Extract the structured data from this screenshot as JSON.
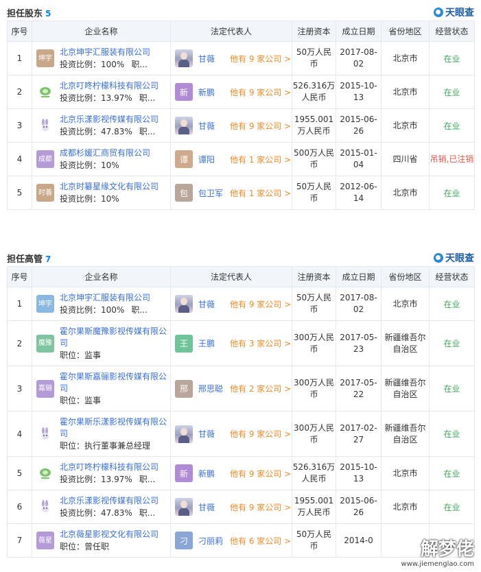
{
  "brand": "天眼查",
  "columns": [
    "序号",
    "企业名称",
    "法定代表人",
    "注册资本",
    "成立日期",
    "省份地区",
    "经营状态"
  ],
  "more_suffix": "职...",
  "shareholder": {
    "title": "担任股东",
    "count": "5",
    "rows": [
      {
        "no": "1",
        "logo": "坤宇",
        "logo_color": "#c9a88a",
        "name": "北京坤宇汇服装有限公司",
        "sub": "投资比例：100%",
        "more": true,
        "legal_photo": true,
        "legal_char": "",
        "legal_color": "",
        "legal": "甘薇",
        "legal_more": "他有 9 家公司 >",
        "capital": "50万人民币",
        "date": "2017-08-02",
        "region": "北京市",
        "status": "在业",
        "status_ok": true
      },
      {
        "no": "2",
        "logo": "",
        "logo_color": "#ffffff",
        "logo_icon": "lemon-icon",
        "name": "北京叮咚柠檬科技有限公司",
        "sub": "投资比例：13.97%",
        "more": true,
        "legal_photo": false,
        "legal_char": "新",
        "legal_color": "#b18ad8",
        "legal": "新鹏",
        "legal_more": "他有 9 家公司 >",
        "capital": "526.316万人民币",
        "date": "2015-10-13",
        "region": "北京市",
        "status": "在业",
        "status_ok": true
      },
      {
        "no": "3",
        "logo": "",
        "logo_color": "#ffffff",
        "logo_icon": "rabbit-icon",
        "name": "北京乐漾影视传媒有限公司",
        "sub": "投资比例：47.83%",
        "more": true,
        "legal_photo": true,
        "legal_char": "",
        "legal_color": "",
        "legal": "甘薇",
        "legal_more": "他有 9 家公司 >",
        "capital": "1955.001万人民币",
        "date": "2015-06-26",
        "region": "北京市",
        "status": "在业",
        "status_ok": true
      },
      {
        "no": "4",
        "logo": "成都",
        "logo_color": "#b49ad6",
        "name": "成都杉媛汇商贸有限公司",
        "sub": "投资比例：10%",
        "more": false,
        "legal_photo": false,
        "legal_char": "谭",
        "legal_color": "#cfa98a",
        "legal": "谭阳",
        "legal_more": "他有 1 家公司 >",
        "capital": "500万人民币",
        "date": "2015-01-04",
        "region": "四川省",
        "status": "吊销,已注销",
        "status_ok": false
      },
      {
        "no": "5",
        "logo": "时善",
        "logo_color": "#c9a88a",
        "name": "北京时纂星缘文化有限公司",
        "sub": "投资比例：10%",
        "more": false,
        "legal_photo": false,
        "legal_char": "包",
        "legal_color": "#b9a59a",
        "legal": "包卫军",
        "legal_more": "他有 1 家公司 >",
        "capital": "50万人民币",
        "date": "2012-06-14",
        "region": "北京市",
        "status": "在业",
        "status_ok": true
      }
    ]
  },
  "executive": {
    "title": "担任高管",
    "count": "7",
    "rows": [
      {
        "no": "1",
        "logo": "坤宇",
        "logo_color": "#8ab8e0",
        "name": "北京坤宇汇服装有限公司",
        "sub": "投资比例：100%",
        "more": true,
        "legal_photo": true,
        "legal_char": "",
        "legal_color": "",
        "legal": "甘薇",
        "legal_more": "他有 9 家公司 >",
        "capital": "50万人民币",
        "date": "2017-08-02",
        "region": "北京市",
        "status": "在业",
        "status_ok": true
      },
      {
        "no": "2",
        "logo": "魔豫",
        "logo_color": "#7fc4a0",
        "name": "霍尔果斯魔豫影视传媒有限公司",
        "sub": "职位：监事",
        "more": false,
        "legal_photo": false,
        "legal_char": "王",
        "legal_color": "#6fc49a",
        "legal": "王鹏",
        "legal_more": "他有 3 家公司 >",
        "capital": "300万人民币",
        "date": "2017-05-23",
        "region": "新疆维吾尔自治区",
        "status": "在业",
        "status_ok": true
      },
      {
        "no": "3",
        "logo": "嘉骊",
        "logo_color": "#b49ad6",
        "name": "霍尔果斯嘉骊影视传媒有限公司",
        "sub": "职位：监事",
        "more": false,
        "legal_photo": false,
        "legal_char": "邢",
        "legal_color": "#b9a59a",
        "legal": "邢思聪",
        "legal_more": "他有 2 家公司 >",
        "capital": "300万人民币",
        "date": "2017-05-22",
        "region": "新疆维吾尔自治区",
        "status": "在业",
        "status_ok": true
      },
      {
        "no": "4",
        "logo": "",
        "logo_color": "#ffffff",
        "logo_icon": "rabbit-icon",
        "name": "霍尔果斯乐漾影视传媒有限公司",
        "sub": "职位：执行董事兼总经理",
        "more": false,
        "legal_photo": true,
        "legal_char": "",
        "legal_color": "",
        "legal": "甘薇",
        "legal_more": "他有 9 家公司 >",
        "capital": "300万人民币",
        "date": "2017-02-27",
        "region": "新疆维吾尔自治区",
        "status": "在业",
        "status_ok": true
      },
      {
        "no": "5",
        "logo": "",
        "logo_color": "#ffffff",
        "logo_icon": "lemon-icon",
        "name": "北京叮咚柠檬科技有限公司",
        "sub": "投资比例：13.97%",
        "more": true,
        "legal_photo": false,
        "legal_char": "新",
        "legal_color": "#b18ad8",
        "legal": "新鹏",
        "legal_more": "他有 9 家公司 >",
        "capital": "526.316万人民币",
        "date": "2015-10-13",
        "region": "北京市",
        "status": "在业",
        "status_ok": true
      },
      {
        "no": "6",
        "logo": "",
        "logo_color": "#ffffff",
        "logo_icon": "rabbit-icon",
        "name": "北京乐漾影视传媒有限公司",
        "sub": "投资比例：47.83%",
        "more": true,
        "legal_photo": true,
        "legal_char": "",
        "legal_color": "",
        "legal": "甘薇",
        "legal_more": "他有 9 家公司 >",
        "capital": "1955.001万人民币",
        "date": "2015-06-26",
        "region": "北京市",
        "status": "在业",
        "status_ok": true
      },
      {
        "no": "7",
        "logo": "薇星",
        "logo_color": "#b49ad6",
        "name": "北京薇星影视文化有限公司",
        "sub": "职位：曾任职",
        "more": false,
        "legal_photo": false,
        "legal_char": "刁",
        "legal_color": "#8aa6d6",
        "legal": "刁丽莉",
        "legal_more": "他有 6 家公司 >",
        "capital": "50万人民币",
        "date": "2014-0",
        "region": "",
        "status": "",
        "status_ok": true
      }
    ]
  },
  "watermark": {
    "main": "解梦佬",
    "url": "www.jiemenglao.com"
  }
}
